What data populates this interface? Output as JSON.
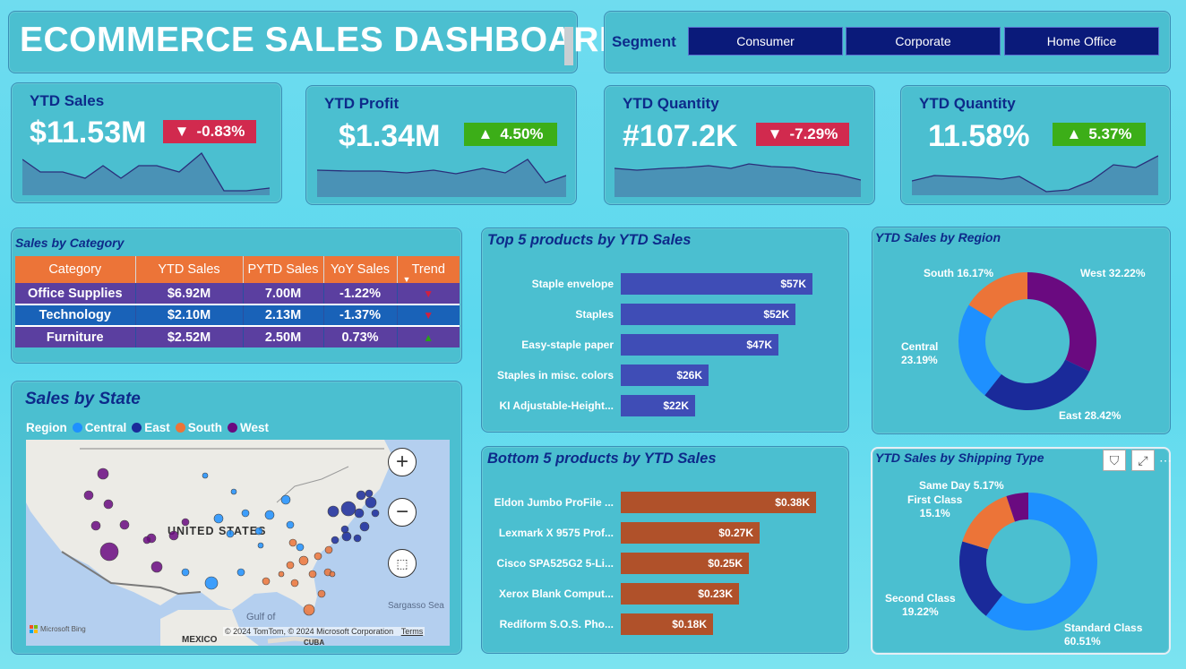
{
  "title": "ECOMMERCE SALES DASHBOARD",
  "segment": {
    "label": "Segment",
    "options": [
      "Consumer",
      "Corporate",
      "Home Office"
    ]
  },
  "kpis": [
    {
      "label": "YTD Sales",
      "value": "$11.53M",
      "change": "-0.83%",
      "direction": "down"
    },
    {
      "label": "YTD Profit",
      "value": "$1.34M",
      "change": "4.50%",
      "direction": "up"
    },
    {
      "label": "YTD Quantity",
      "value": "#107.2K",
      "change": "-7.29%",
      "direction": "down"
    },
    {
      "label": "YTD Quantity",
      "value": "11.58%",
      "change": "5.37%",
      "direction": "up"
    }
  ],
  "colors": {
    "down": "#d12a4e",
    "up": "#3cae18",
    "central": "#1e90ff",
    "east": "#1a2a9a",
    "south": "#ec7438",
    "west": "#6a0a80"
  },
  "category": {
    "title": "Sales by Category",
    "headers": [
      "Category",
      "YTD Sales",
      "PYTD Sales",
      "YoY Sales",
      "Trend"
    ],
    "rows": [
      {
        "category": "Office Supplies",
        "ytd": "$6.92M",
        "pytd": "7.00M",
        "yoy": "-1.22%",
        "trend": "down"
      },
      {
        "category": "Technology",
        "ytd": "$2.10M",
        "pytd": "2.13M",
        "yoy": "-1.37%",
        "trend": "down"
      },
      {
        "category": "Furniture",
        "ytd": "$2.52M",
        "pytd": "2.50M",
        "yoy": "0.73%",
        "trend": "up"
      }
    ]
  },
  "state_map": {
    "title": "Sales by State",
    "legend_title": "Region",
    "legend": [
      "Central",
      "East",
      "South",
      "West"
    ],
    "labels": {
      "country": "UNITED STATES",
      "mexico": "MEXICO",
      "gulf1": "Gulf of",
      "sargasso": "Sargasso Sea",
      "cuba": "CUBA"
    },
    "attribution": "© 2024 TomTom, © 2024 Microsoft Corporation",
    "terms": "Terms",
    "brand": "Microsoft Bing"
  },
  "top5": {
    "title": "Top 5 products by YTD Sales",
    "chart_data": {
      "type": "bar",
      "categories": [
        "Staple envelope",
        "Staples",
        "Easy-staple paper",
        "Staples in misc. colors",
        "KI Adjustable-Height..."
      ],
      "values": [
        57,
        52,
        47,
        26,
        22
      ],
      "labels": [
        "$57K",
        "$52K",
        "$47K",
        "$26K",
        "$22K"
      ]
    }
  },
  "bottom5": {
    "title": "Bottom 5 products by YTD Sales",
    "chart_data": {
      "type": "bar",
      "categories": [
        "Eldon Jumbo ProFile ...",
        "Lexmark X 9575 Prof...",
        "Cisco SPA525G2 5-Li...",
        "Xerox Blank Comput...",
        "Rediform S.O.S. Pho..."
      ],
      "values": [
        0.38,
        0.27,
        0.25,
        0.23,
        0.18
      ],
      "labels": [
        "$0.38K",
        "$0.27K",
        "$0.25K",
        "$0.23K",
        "$0.18K"
      ]
    }
  },
  "region": {
    "title": "YTD Sales by Region",
    "chart_data": {
      "type": "pie",
      "categories": [
        "West",
        "East",
        "Central",
        "South"
      ],
      "values": [
        32.22,
        28.42,
        23.19,
        16.17
      ],
      "labels": [
        "West 32.22%",
        "East 28.42%",
        "Central\n23.19%",
        "South 16.17%"
      ]
    }
  },
  "shipping": {
    "title": "YTD Sales by Shipping Type",
    "chart_data": {
      "type": "pie",
      "categories": [
        "Standard Class",
        "Second Class",
        "First Class",
        "Same Day"
      ],
      "values": [
        60.51,
        19.22,
        15.1,
        5.17
      ],
      "labels": [
        "Standard Class\n60.51%",
        "Second Class\n19.22%",
        "First Class\n15.1%",
        "Same Day 5.17%"
      ]
    }
  }
}
